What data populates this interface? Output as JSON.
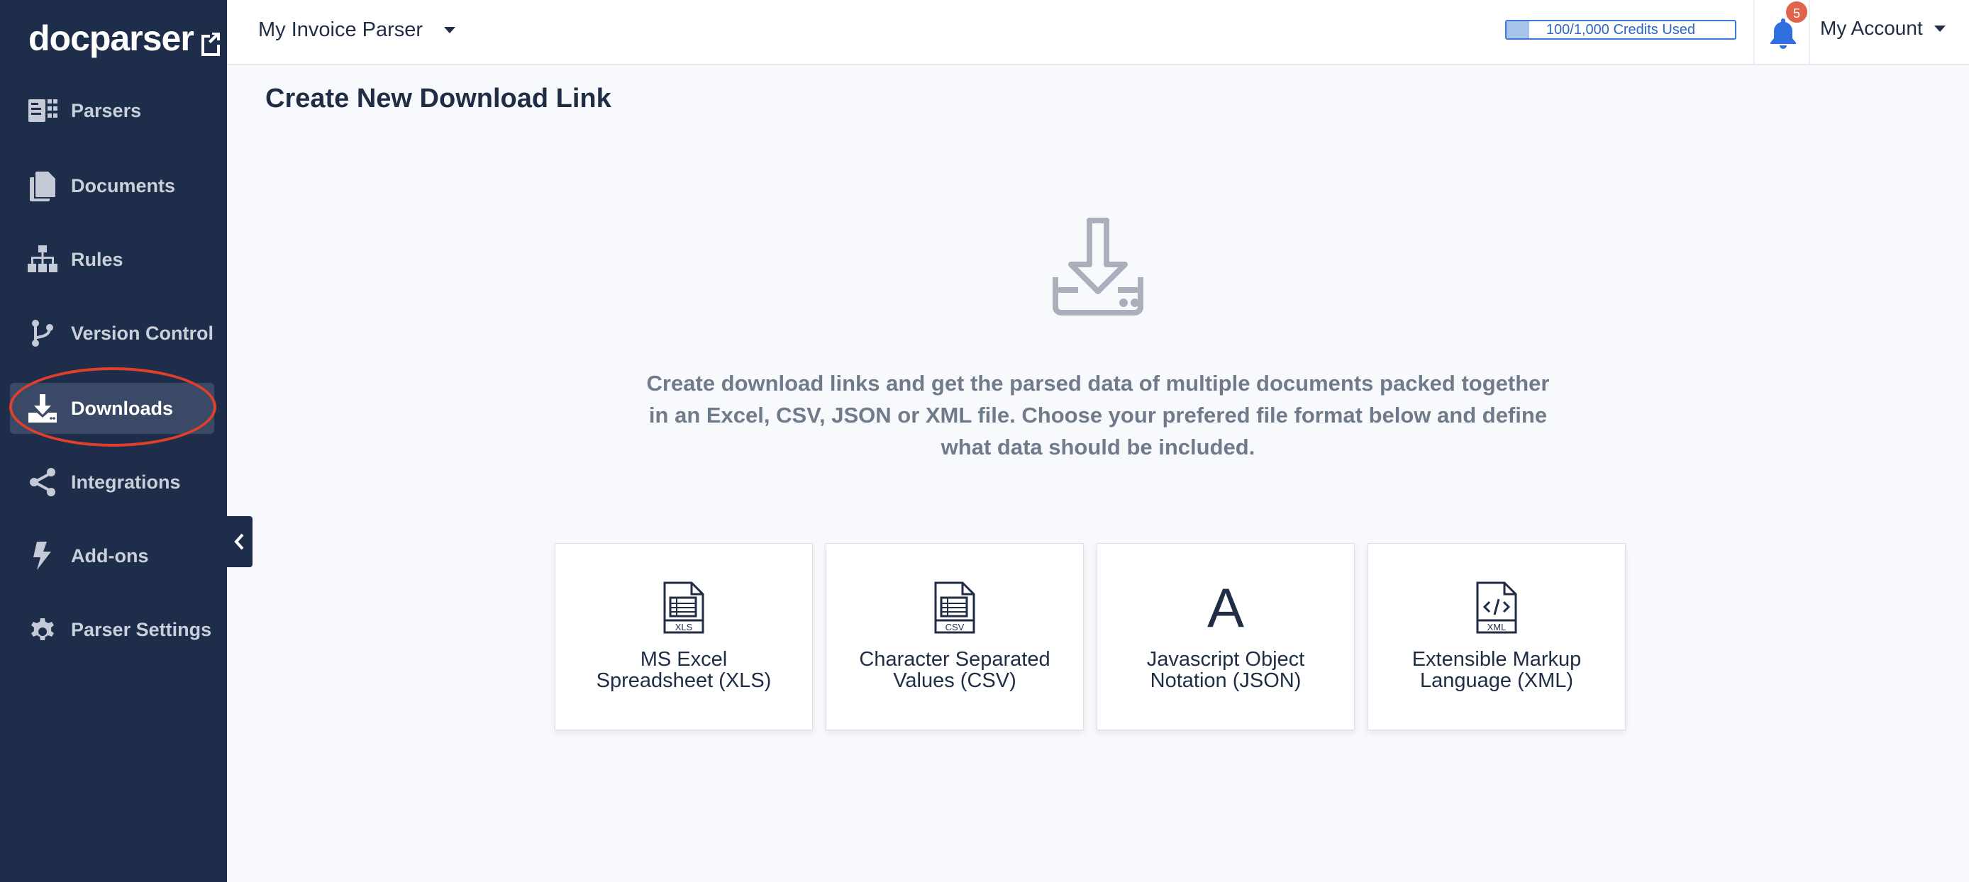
{
  "app": {
    "logo_text": "docparser"
  },
  "sidebar": {
    "items": [
      {
        "label": "Parsers",
        "icon": "parsers-icon"
      },
      {
        "label": "Documents",
        "icon": "documents-icon"
      },
      {
        "label": "Rules",
        "icon": "rules-icon"
      },
      {
        "label": "Version Control",
        "icon": "branch-icon"
      },
      {
        "label": "Downloads",
        "icon": "download-icon",
        "active": true
      },
      {
        "label": "Integrations",
        "icon": "share-icon"
      },
      {
        "label": "Add-ons",
        "icon": "bolt-icon"
      },
      {
        "label": "Parser Settings",
        "icon": "gear-icon"
      }
    ]
  },
  "header": {
    "parser_name": "My Invoice Parser",
    "credits_text": "100/1,000 Credits Used",
    "credits_used_fraction": 0.1,
    "notification_count": "5",
    "account_label": "My Account"
  },
  "main": {
    "title": "Create New Download Link",
    "description": "Create download links and get the parsed data of multiple documents packed together in an Excel, CSV, JSON or XML file. Choose your prefered file format below and define what data should be included.",
    "formats": [
      {
        "line1": "MS Excel",
        "line2": "Spreadsheet (XLS)",
        "icon": "xls-file-icon",
        "tag": "XLS"
      },
      {
        "line1": "Character Separated",
        "line2": "Values (CSV)",
        "icon": "csv-file-icon",
        "tag": "CSV"
      },
      {
        "line1": "Javascript Object",
        "line2": "Notation (JSON)",
        "icon": "json-icon",
        "glyph": "A"
      },
      {
        "line1": "Extensible Markup",
        "line2": "Language (XML)",
        "icon": "xml-file-icon",
        "tag": "XML"
      }
    ]
  },
  "colors": {
    "sidebar_bg": "#1e2d4a",
    "accent_blue": "#2b66c4",
    "highlight_red": "#e0402a",
    "badge": "#e0644a"
  }
}
